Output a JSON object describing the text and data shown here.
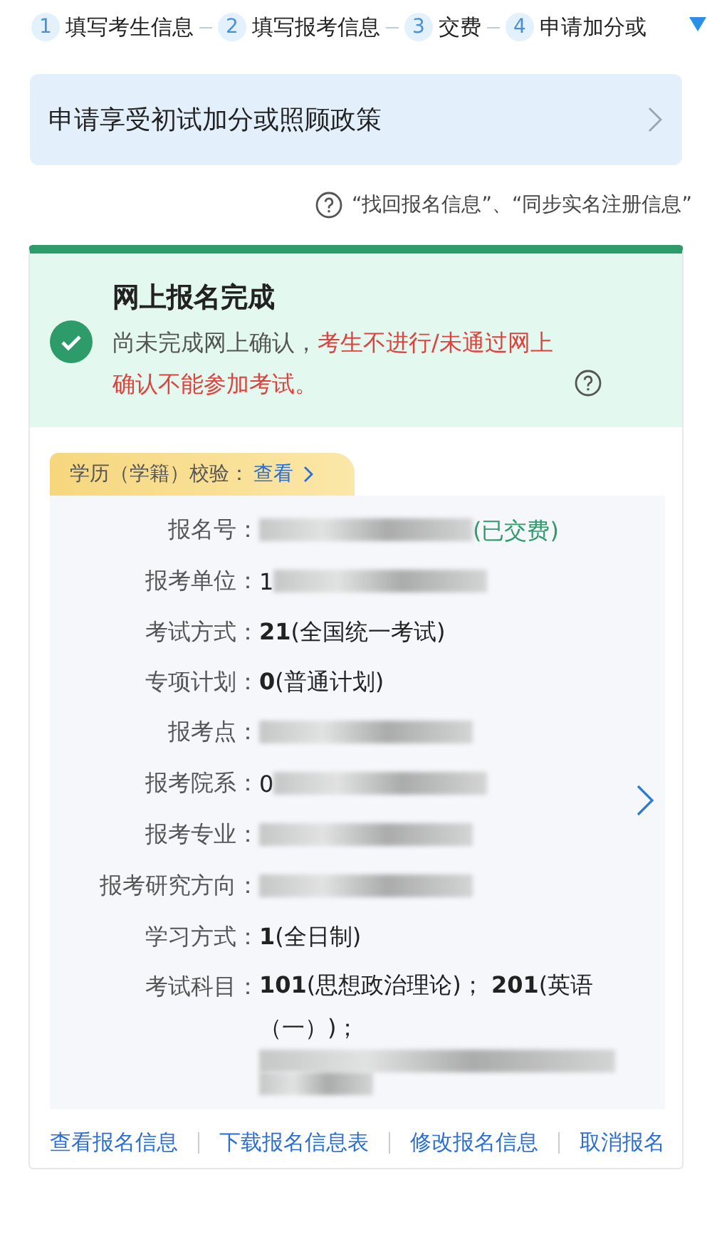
{
  "steps": [
    {
      "number": "1",
      "label": "填写考生信息"
    },
    {
      "number": "2",
      "label": "填写报考信息"
    },
    {
      "number": "3",
      "label": "交费"
    },
    {
      "number": "4",
      "label": "申请加分或"
    }
  ],
  "policy": {
    "label": "申请享受初试加分或照顾政策"
  },
  "help": {
    "text": "“找回报名信息”、“同步实名注册信息”"
  },
  "status": {
    "title": "网上报名完成",
    "message": "尚未完成网上确认，",
    "warning": "考生不进行/未通过网上确认不能参加考试。"
  },
  "verify": {
    "label": "学历（学籍）校验：",
    "link": "查看"
  },
  "fields": [
    {
      "label": "报名号：",
      "kind": "redacted",
      "note": "(已交费)"
    },
    {
      "label": "报考单位：",
      "kind": "redacted",
      "value": "1"
    },
    {
      "label": "考试方式：",
      "kind": "text",
      "value": "**21**(全国统一考试)"
    },
    {
      "label": "专项计划：",
      "kind": "text",
      "value": "**0**(普通计划)"
    },
    {
      "label": "报考点：",
      "kind": "redacted"
    },
    {
      "label": "报考院系：",
      "kind": "redacted",
      "value": "0"
    },
    {
      "label": "报考专业：",
      "kind": "redacted"
    },
    {
      "label": "报考研究方向：",
      "kind": "redacted"
    },
    {
      "label": "学习方式：",
      "kind": "text",
      "value": "**1**(全日制)"
    },
    {
      "label": "考试科目：",
      "kind": "multiline",
      "value": "**101**(思想政治理论)； **201**(英语（一）)；"
    }
  ],
  "actions": [
    "查看报名信息",
    "下载报名信息表",
    "修改报名信息",
    "取消报名"
  ]
}
